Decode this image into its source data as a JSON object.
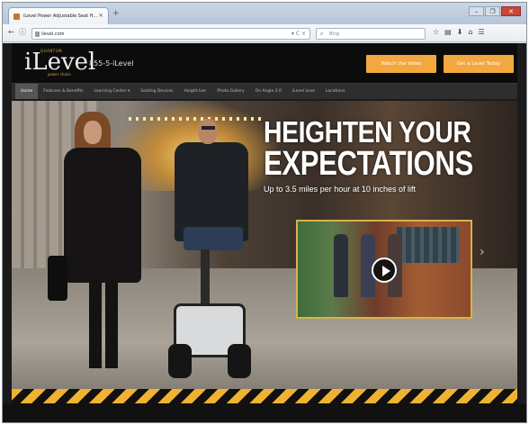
{
  "browser": {
    "tab_title": "iLevel Power Adjustable Seat H...",
    "tab_close": "×",
    "new_tab": "+",
    "url": "ilevel.com",
    "url_controls": "▾ C ×",
    "search_placeholder": "Bing",
    "window_controls": [
      "–",
      "❐",
      "✕"
    ],
    "toolbar_icons": [
      "☆",
      "▤",
      "⬇",
      "⌂",
      "☰"
    ]
  },
  "header": {
    "brand_top": "QUANTUM",
    "brand_main": "iLevel",
    "brand_sub": "power chairs",
    "phone": "855-5-iLevel",
    "cta_video": "Watch the Video",
    "cta_test": "Get a Level Today"
  },
  "nav": {
    "items": [
      "Home",
      "Features & Benefits",
      "Learning Center ▾",
      "Seating Devices",
      "Height.lver",
      "Photo Gallery",
      "On Angle 2.0",
      "iLevel Love",
      "Locations"
    ],
    "active_index": 0
  },
  "hero": {
    "line1": "HEIGHTEN YOUR",
    "line2": "EXPECTATIONS",
    "subtitle": "Up to 3.5 miles per hour at 10 inches of lift",
    "next_arrow": "›"
  },
  "colors": {
    "accent": "#f2a83e",
    "hazard_yellow": "#f0b232",
    "video_border": "#d8b24a",
    "nav_bg": "#2e2e2e"
  }
}
